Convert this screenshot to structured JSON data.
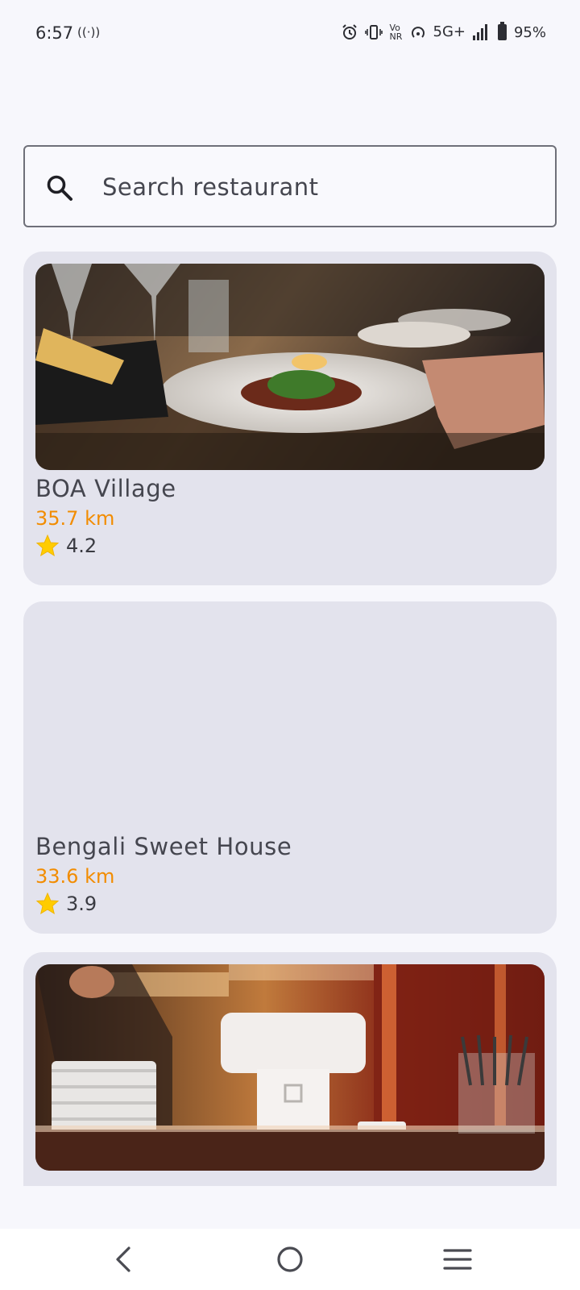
{
  "status_bar": {
    "time": "6:57",
    "left_extra": "((·))",
    "network": "5G+",
    "volte": "Vo NR",
    "battery": "95%"
  },
  "search": {
    "placeholder": "Search restaurant"
  },
  "restaurants": [
    {
      "name": "BOA Village",
      "distance": "35.7 km",
      "rating": "4.2",
      "has_photo": true
    },
    {
      "name": "Bengali Sweet House",
      "distance": "33.6 km",
      "rating": "3.9",
      "has_photo": false
    },
    {
      "name": "",
      "distance": "",
      "rating": "",
      "has_photo": true
    }
  ],
  "colors": {
    "background": "#f7f7fc",
    "card": "#e3e3ed",
    "distance": "#f28c00",
    "star": "#ffcc00"
  },
  "nav": {
    "back_icon": "chevron-left-icon",
    "home_icon": "circle-home-icon",
    "recents_icon": "menu-lines-icon"
  }
}
